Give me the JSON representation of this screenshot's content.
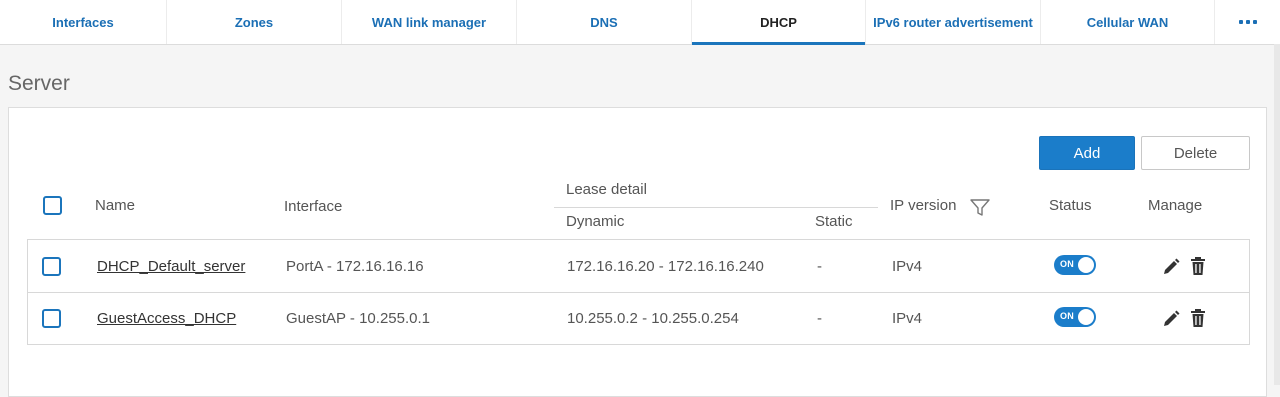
{
  "tabs": [
    {
      "label": "Interfaces",
      "active": false
    },
    {
      "label": "Zones",
      "active": false
    },
    {
      "label": "WAN link manager",
      "active": false
    },
    {
      "label": "DNS",
      "active": false
    },
    {
      "label": "DHCP",
      "active": true
    },
    {
      "label": "IPv6 router advertisement",
      "active": false
    },
    {
      "label": "Cellular WAN",
      "active": false
    }
  ],
  "more_icon": "more-horizontal-icon",
  "section_title": "Server",
  "toolbar": {
    "add_label": "Add",
    "delete_label": "Delete"
  },
  "table": {
    "headers": {
      "name": "Name",
      "interface": "Interface",
      "lease_detail": "Lease detail",
      "dynamic": "Dynamic",
      "static": "Static",
      "ip_version": "IP version",
      "status": "Status",
      "manage": "Manage"
    },
    "rows": [
      {
        "name": "DHCP_Default_server",
        "interface": "PortA - 172.16.16.16",
        "dynamic": "172.16.16.20 - 172.16.16.240",
        "static": "-",
        "ip_version": "IPv4",
        "status": "ON"
      },
      {
        "name": "GuestAccess_DHCP",
        "interface": "GuestAP - 10.255.0.1",
        "dynamic": "10.255.0.2 - 10.255.0.254",
        "static": "-",
        "ip_version": "IPv4",
        "status": "ON"
      }
    ]
  },
  "colors": {
    "accent": "#1b7dca",
    "tab_text": "#1b6fb5"
  },
  "icons": {
    "filter": "filter-icon",
    "edit": "pencil-icon",
    "delete": "trash-icon"
  }
}
